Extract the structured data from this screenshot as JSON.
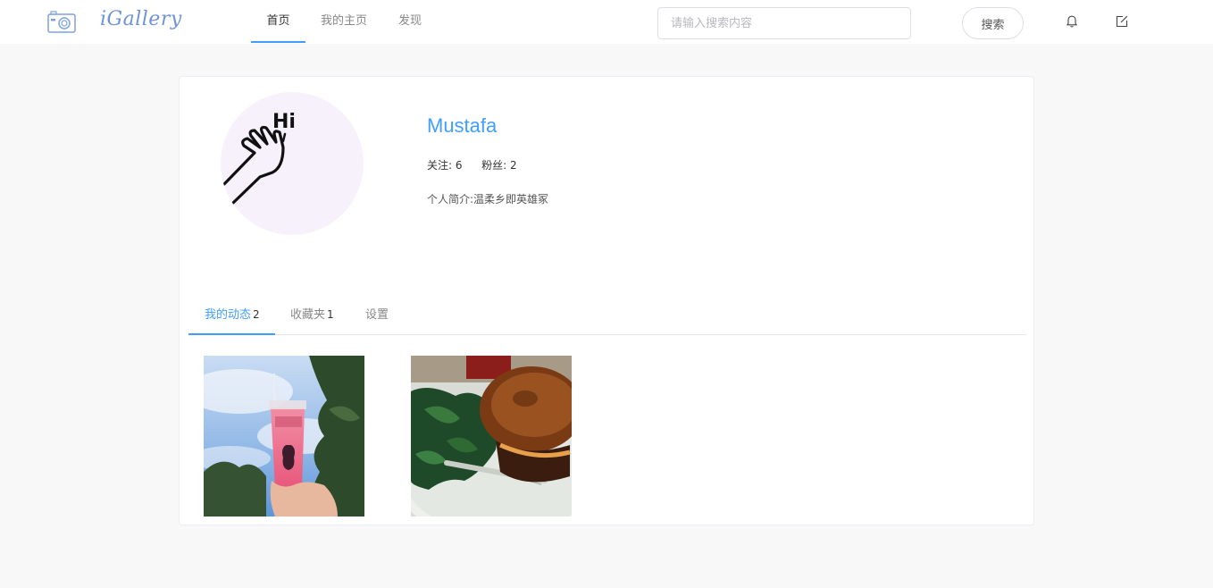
{
  "header": {
    "logo_text": "iGallery",
    "nav": {
      "home": "首页",
      "mine": "我的主页",
      "discover": "发现"
    },
    "search": {
      "placeholder": "请输入搜索内容",
      "value": "",
      "button_label": "搜索"
    },
    "icons": [
      "camera-logo-icon",
      "bell-icon",
      "edit-icon"
    ]
  },
  "profile": {
    "username": "Mustafa",
    "following_label": "关注:",
    "following_count": "6",
    "followers_label": "粉丝:",
    "followers_count": "2",
    "bio_label": "个人简介:",
    "bio_text": "温柔乡即英雄冢",
    "avatar_text": "Hi"
  },
  "tabs": [
    {
      "label": "我的动态",
      "count": "2"
    },
    {
      "label": "收藏夹",
      "count": "1"
    },
    {
      "label": "设置",
      "count": ""
    }
  ],
  "posts": [
    {
      "subject": "pink-drink-photo"
    },
    {
      "subject": "bagel-salad-photo"
    }
  ],
  "colors": {
    "accent": "#409eff",
    "logo": "#6f93d6",
    "page_bg": "#f8f8f8"
  }
}
